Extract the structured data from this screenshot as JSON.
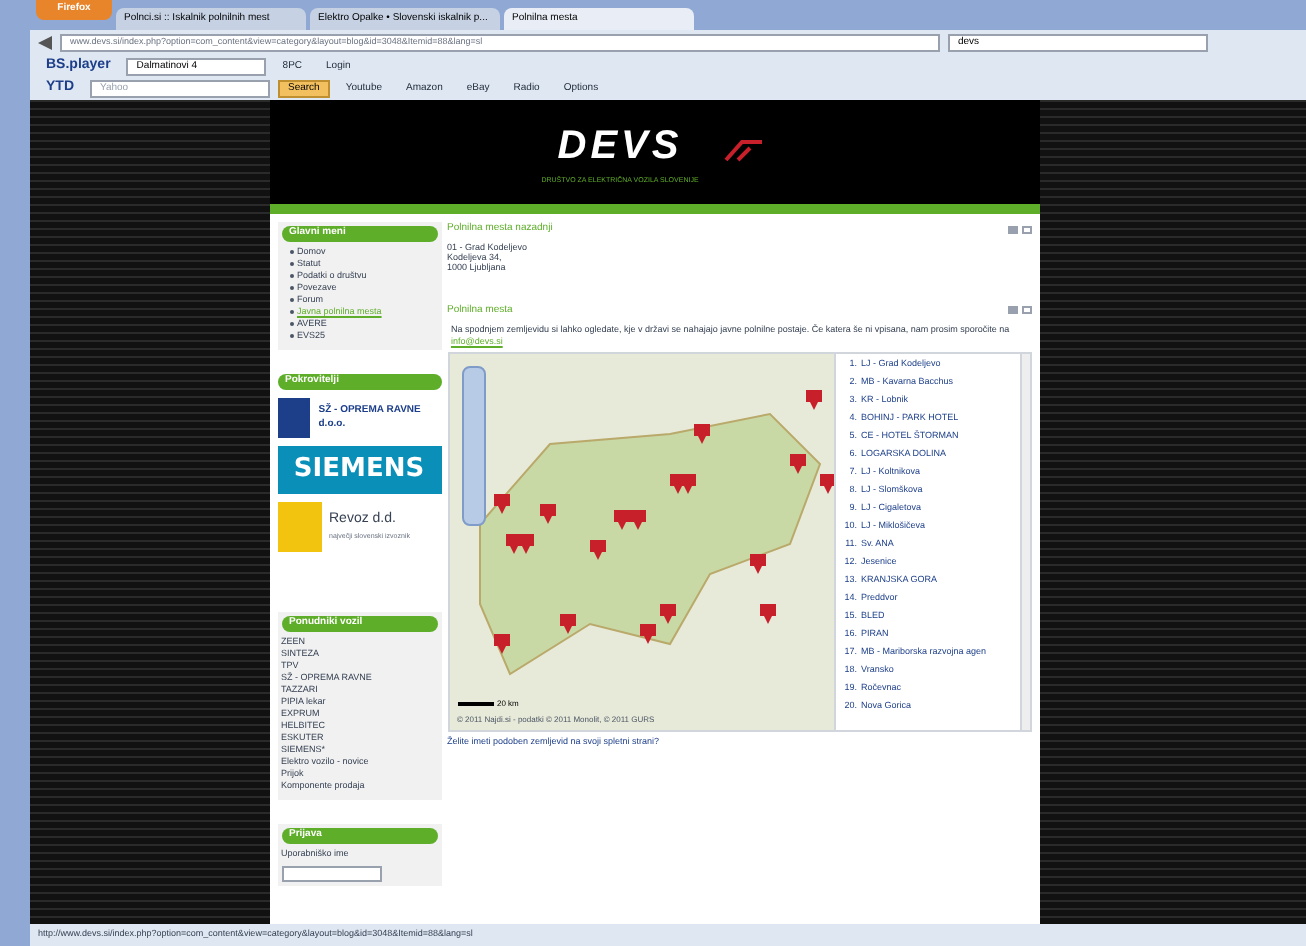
{
  "browser": {
    "app_button": "Firefox",
    "tabs": [
      {
        "label": "Polnci.si :: Iskalnik polnilnih mest",
        "selected": false
      },
      {
        "label": "Elektro Opalke • Slovenski iskalnik p...",
        "selected": false
      },
      {
        "label": "Polnilna mesta",
        "selected": true
      }
    ],
    "address": "www.devs.si/index.php?option=com_content&view=category&layout=blog&id=3048&Itemid=88&lang=sl",
    "search": "devs",
    "toolbar_1": [
      {
        "kind": "logo",
        "text": "BS.player"
      },
      {
        "kind": "dropdown",
        "text": "Dalmatinovi 4"
      },
      {
        "kind": "link",
        "text": "8PC"
      },
      {
        "kind": "link",
        "text": "Login"
      }
    ],
    "toolbar_2": [
      {
        "kind": "logo",
        "text": "YTD"
      },
      {
        "kind": "field",
        "text": "Yahoo"
      },
      {
        "kind": "button",
        "text": "Search"
      },
      {
        "kind": "link",
        "text": "Youtube"
      },
      {
        "kind": "link",
        "text": "Amazon"
      },
      {
        "kind": "link",
        "text": "eBay"
      },
      {
        "kind": "link",
        "text": "Radio"
      },
      {
        "kind": "link",
        "text": "Options"
      }
    ],
    "status_bar": "http://www.devs.si/index.php?option=com_content&view=category&layout=blog&id=3048&Itemid=88&lang=sl"
  },
  "header": {
    "logo": "DEVS",
    "tagline": "DRUŠTVO ZA ELEKTRIČNA VOZILA SLOVENIJE"
  },
  "sidebar": {
    "main_menu": {
      "title": "Glavni meni",
      "items": [
        {
          "label": "Domov",
          "selected": false
        },
        {
          "label": "Statut",
          "selected": false
        },
        {
          "label": "Podatki o društvu",
          "selected": false
        },
        {
          "label": "Povezave",
          "selected": false
        },
        {
          "label": "Forum",
          "selected": false
        },
        {
          "label": "Javna polnilna mesta",
          "selected": true
        },
        {
          "label": "AVERE",
          "selected": false
        },
        {
          "label": "EVS25",
          "selected": false
        }
      ]
    },
    "sponsors": {
      "title": "Pokrovitelji",
      "items": [
        {
          "kind": "oprema",
          "text": "SŽ - OPREMA RAVNE d.o.o."
        },
        {
          "kind": "siemens",
          "text": "SIEMENS"
        },
        {
          "kind": "revoz",
          "text": "Revoz d.d.",
          "subtext": "največji slovenski izvoznik"
        }
      ]
    },
    "vendors": {
      "title": "Ponudniki vozil",
      "items": [
        "ZEEN",
        "SINTEZA",
        "TPV",
        "SŽ - OPREMA RAVNE",
        "TAZZARI",
        "PIPIA lekar",
        "EXPRUM",
        "HELBITEC",
        "ESKUTER",
        "SIEMENS*",
        "Elektro vozilo - novice",
        "Prijok",
        "Komponente prodaja"
      ]
    },
    "login": {
      "title": "Prijava",
      "label": "Uporabniško ime"
    }
  },
  "content": {
    "latest": {
      "title": "Polnilna mesta nazadnji",
      "lines": [
        "01 - Grad Kodeljevo",
        "Kodeljeva 34,",
        "1000 Ljubljana"
      ]
    },
    "stations": {
      "title": "Polnilna mesta",
      "text": "Na spodnjem zemljevidu si lahko ogledate, kje v državi se nahajajo javne polnilne postaje. Če katera še ni vpisana, nam prosim sporočite na",
      "email": "info@devs.si",
      "map": {
        "scale": "20 km",
        "attribution": "© 2011 Najdi.si - podatki © 2011 Monolit, © 2011 GURS"
      },
      "list": [
        {
          "number": "1.",
          "name": "LJ - Grad Kodeljevo"
        },
        {
          "number": "2.",
          "name": "MB - Kavarna Bacchus"
        },
        {
          "number": "3.",
          "name": "KR - Lobnik"
        },
        {
          "number": "4.",
          "name": "BOHINJ - PARK HOTEL"
        },
        {
          "number": "5.",
          "name": "CE - HOTEL ŠTORMAN"
        },
        {
          "number": "6.",
          "name": "LOGARSKA DOLINA"
        },
        {
          "number": "7.",
          "name": "LJ - Koltnikova"
        },
        {
          "number": "8.",
          "name": "LJ - Slomškova"
        },
        {
          "number": "9.",
          "name": "LJ - Cigaletova"
        },
        {
          "number": "10.",
          "name": "LJ - Miklošičeva"
        },
        {
          "number": "11.",
          "name": "Sv. ANA"
        },
        {
          "number": "12.",
          "name": "Jesenice"
        },
        {
          "number": "13.",
          "name": "KRANJSKA GORA"
        },
        {
          "number": "14.",
          "name": "Preddvor"
        },
        {
          "number": "15.",
          "name": "BLED"
        },
        {
          "number": "16.",
          "name": "PIRAN"
        },
        {
          "number": "17.",
          "name": "MB - Mariborska razvojna agen"
        },
        {
          "number": "18.",
          "name": "Vransko"
        },
        {
          "number": "19.",
          "name": "Ročevnac"
        },
        {
          "number": "20.",
          "name": "Nova Gorica"
        }
      ]
    },
    "map_question": "Želite imeti podoben zemljevid na svoji spletni strani?"
  }
}
